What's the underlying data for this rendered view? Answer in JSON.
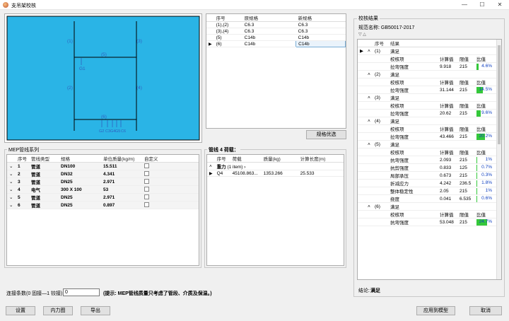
{
  "window": {
    "title": "支吊架校核",
    "min_icon": "minimize-icon",
    "max_icon": "maximize-icon",
    "close_icon": "close-icon"
  },
  "drawing": {
    "labels": [
      "(1)",
      "(3)",
      "(5)",
      "(2)",
      "(4)",
      "(6)",
      "G1"
    ],
    "bottom_labels": [
      "G2",
      "C3",
      "G4",
      "G5",
      "C6"
    ],
    "colors": {
      "background": "#2ab4e6",
      "frame": "#000000",
      "member_labels": "#3060c0"
    }
  },
  "spec_table": {
    "headers": [
      "序号",
      "原规格",
      "新规格"
    ],
    "rows": [
      {
        "no": "(1),(2)",
        "old": "C6.3",
        "new": "C6.3"
      },
      {
        "no": "(3),(4)",
        "old": "C6.3",
        "new": "C6.3"
      },
      {
        "no": "(5)",
        "old": "C14b",
        "new": "C14b"
      },
      {
        "no": "(6)",
        "old": "C14b",
        "new": "C14b"
      }
    ],
    "optimize_button": "规格优选"
  },
  "mep": {
    "title": "MEP管线系列",
    "headers": [
      "序号",
      "管线类型",
      "规格",
      "单位质量(kg/m)",
      "自定义"
    ],
    "rows": [
      {
        "no": "1",
        "type": "管道",
        "spec": "DN100",
        "mass": "15.511"
      },
      {
        "no": "2",
        "type": "管道",
        "spec": "DN32",
        "mass": "4.341"
      },
      {
        "no": "3",
        "type": "管道",
        "spec": "DN25",
        "mass": "2.971"
      },
      {
        "no": "4",
        "type": "电气",
        "spec": "300 X 100",
        "mass": "53"
      },
      {
        "no": "5",
        "type": "管道",
        "spec": "DN25",
        "mass": "2.971"
      },
      {
        "no": "6",
        "type": "管道",
        "spec": "DN25",
        "mass": "0.897"
      }
    ]
  },
  "load": {
    "title": "管线 4 荷载：",
    "headers": [
      "序号",
      "荷载",
      "质量(kg)",
      "计算长度(m)"
    ],
    "group": "重力",
    "group_count": "(1 item)",
    "row": {
      "no": "Q4",
      "load": "45108.863...",
      "mass": "1353.266",
      "length": "25.533"
    }
  },
  "results": {
    "title": "校核结果",
    "spec_label": "规范名称: GB50017-2017",
    "headers": [
      "序号",
      "结果"
    ],
    "sub_headers": [
      "校核项",
      "计算值",
      "限值",
      "比值"
    ],
    "sections": [
      {
        "no": "(1)",
        "result": "满足",
        "items": [
          {
            "name": "拉弯强度",
            "calc": "9.918",
            "limit": "215",
            "ratio": "4.6%",
            "fill": 0.046
          }
        ]
      },
      {
        "no": "(2)",
        "result": "满足",
        "items": [
          {
            "name": "拉弯强度",
            "calc": "31.144",
            "limit": "215",
            "ratio": "14.5%",
            "fill": 0.145
          }
        ]
      },
      {
        "no": "(3)",
        "result": "满足",
        "items": [
          {
            "name": "拉弯强度",
            "calc": "20.62",
            "limit": "215",
            "ratio": "9.6%",
            "fill": 0.096
          }
        ]
      },
      {
        "no": "(4)",
        "result": "满足",
        "items": [
          {
            "name": "拉弯强度",
            "calc": "43.466",
            "limit": "215",
            "ratio": "20.2%",
            "fill": 0.202
          }
        ]
      },
      {
        "no": "(5)",
        "result": "满足",
        "items": [
          {
            "name": "抗弯强度",
            "calc": "2.093",
            "limit": "215",
            "ratio": "1%",
            "fill": 0.01
          },
          {
            "name": "抗剪强度",
            "calc": "0.833",
            "limit": "125",
            "ratio": "0.7%",
            "fill": 0.007
          },
          {
            "name": "局部承压",
            "calc": "0.673",
            "limit": "215",
            "ratio": "0.3%",
            "fill": 0.003
          },
          {
            "name": "折减应力",
            "calc": "4.242",
            "limit": "236.5",
            "ratio": "1.8%",
            "fill": 0.018
          },
          {
            "name": "整体稳定性",
            "calc": "2.05",
            "limit": "215",
            "ratio": "1%",
            "fill": 0.01
          },
          {
            "name": "挠度",
            "calc": "0.041",
            "limit": "6.535",
            "ratio": "0.6%",
            "fill": 0.006
          }
        ]
      },
      {
        "no": "(6)",
        "result": "满足",
        "items": [
          {
            "name": "抗弯强度",
            "calc": "53.048",
            "limit": "215",
            "ratio": "24.7%",
            "fill": 0.247
          }
        ]
      }
    ],
    "conclusion_label": "结论:",
    "conclusion_value": "满足"
  },
  "bottom": {
    "count_label": "连接条数(0 固接—1 铰接):",
    "count_value": "0",
    "hint": "(提示: MEP管线质量只考虑了管段、介质及保温。)",
    "settings": "设置",
    "internal_force": "内力图",
    "export": "导出",
    "apply": "应用到模型",
    "cancel": "取消"
  }
}
